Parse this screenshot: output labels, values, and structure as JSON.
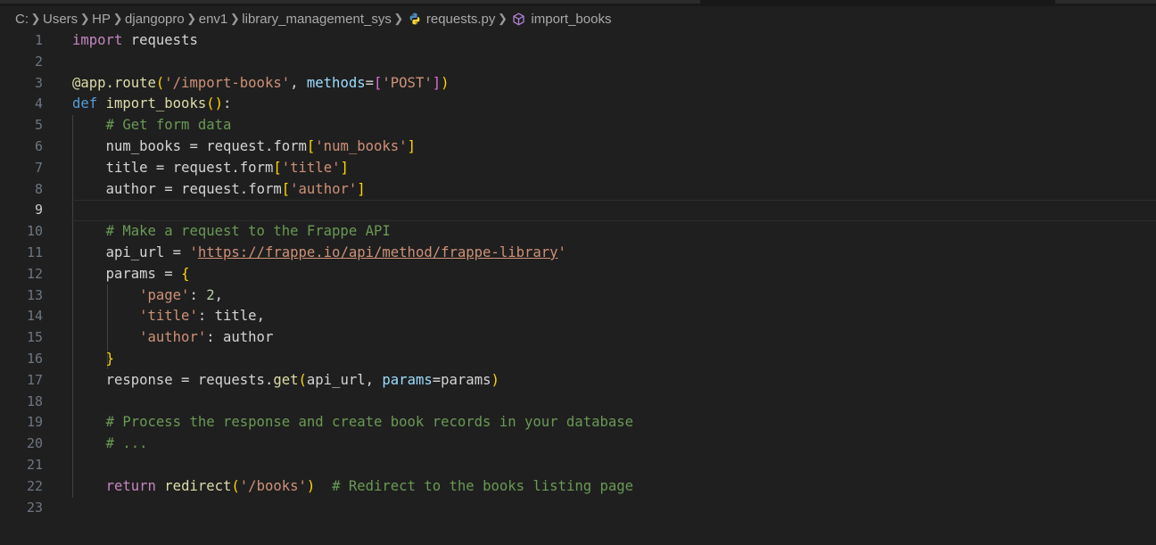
{
  "breadcrumb": {
    "items": [
      "C:",
      "Users",
      "HP",
      "djangopro",
      "env1",
      "library_management_sys"
    ],
    "file": "requests.py",
    "symbol": "import_books",
    "file_icon": "python-icon",
    "symbol_icon": "method-icon",
    "separator_icon": "chevron-right-icon"
  },
  "editor": {
    "language": "python",
    "current_line": 9,
    "line_numbers": [
      "1",
      "2",
      "3",
      "4",
      "5",
      "6",
      "7",
      "8",
      "9",
      "10",
      "11",
      "12",
      "13",
      "14",
      "15",
      "16",
      "17",
      "18",
      "19",
      "20",
      "21",
      "22",
      "23"
    ],
    "lines": [
      "import requests",
      "",
      "@app.route('/import-books', methods=['POST'])",
      "def import_books():",
      "    # Get form data",
      "    num_books = request.form['num_books']",
      "    title = request.form['title']",
      "    author = request.form['author']",
      "",
      "    # Make a request to the Frappe API",
      "    api_url = 'https://frappe.io/api/method/frappe-library'",
      "    params = {",
      "        'page': 2,",
      "        'title': title,",
      "        'author': author",
      "    }",
      "    response = requests.get(api_url, params=params)",
      "",
      "    # Process the response and create book records in your database",
      "    # ...",
      "",
      "    return redirect('/books')  # Redirect to the books listing page",
      ""
    ]
  },
  "theme": {
    "background": "#1f1f1f",
    "line_number": "#6e7681",
    "keyword_control": "#c586c0",
    "keyword": "#569cd6",
    "function": "#dcdcaa",
    "string": "#ce9178",
    "number": "#b5cea8",
    "comment": "#6a9955",
    "parameter": "#9cdcfe",
    "bracket_1": "#ffd700",
    "bracket_2": "#da70d6",
    "bracket_3": "#179fff",
    "python_icon_blue": "#4b8bbe",
    "python_icon_yellow": "#ffd43b",
    "method_icon": "#b180d7"
  }
}
